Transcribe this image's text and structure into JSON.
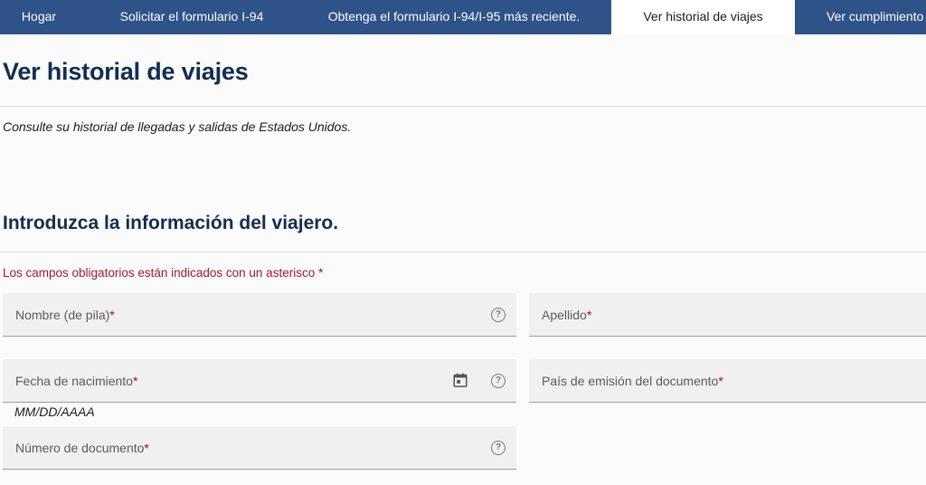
{
  "nav": {
    "tabs": [
      {
        "label": "Hogar"
      },
      {
        "label": "Solicitar el formulario I-94"
      },
      {
        "label": "Obtenga el formulario I-94/I-95 más reciente."
      },
      {
        "label": "Ver historial de viajes"
      },
      {
        "label": "Ver cumplimiento"
      }
    ],
    "active_index": 3
  },
  "page": {
    "title": "Ver historial de viajes",
    "intro": "Consulte su historial de llegadas y salidas de Estados Unidos."
  },
  "form": {
    "section_title": "Introduzca la información del viajero.",
    "required_note": "Los campos obligatorios están indicados con un asterisco",
    "required_marker": "*",
    "fields": {
      "first_name": {
        "label": "Nombre (de pila)",
        "value": ""
      },
      "last_name": {
        "label": "Apellido",
        "value": ""
      },
      "birth_date": {
        "label": "Fecha de nacimiento",
        "value": "",
        "hint": "MM/DD/AAAA"
      },
      "issuing_country": {
        "label": "País de emisión del documento",
        "value": ""
      },
      "document_number": {
        "label": "Número de documento",
        "value": ""
      }
    },
    "help_glyph": "?"
  },
  "icons": {
    "help": "help-circle-icon",
    "calendar": "calendar-icon"
  },
  "colors": {
    "nav_bg": "#2d5389",
    "heading": "#112e51",
    "required": "#b50909",
    "field_bg": "#f0f0f0"
  }
}
